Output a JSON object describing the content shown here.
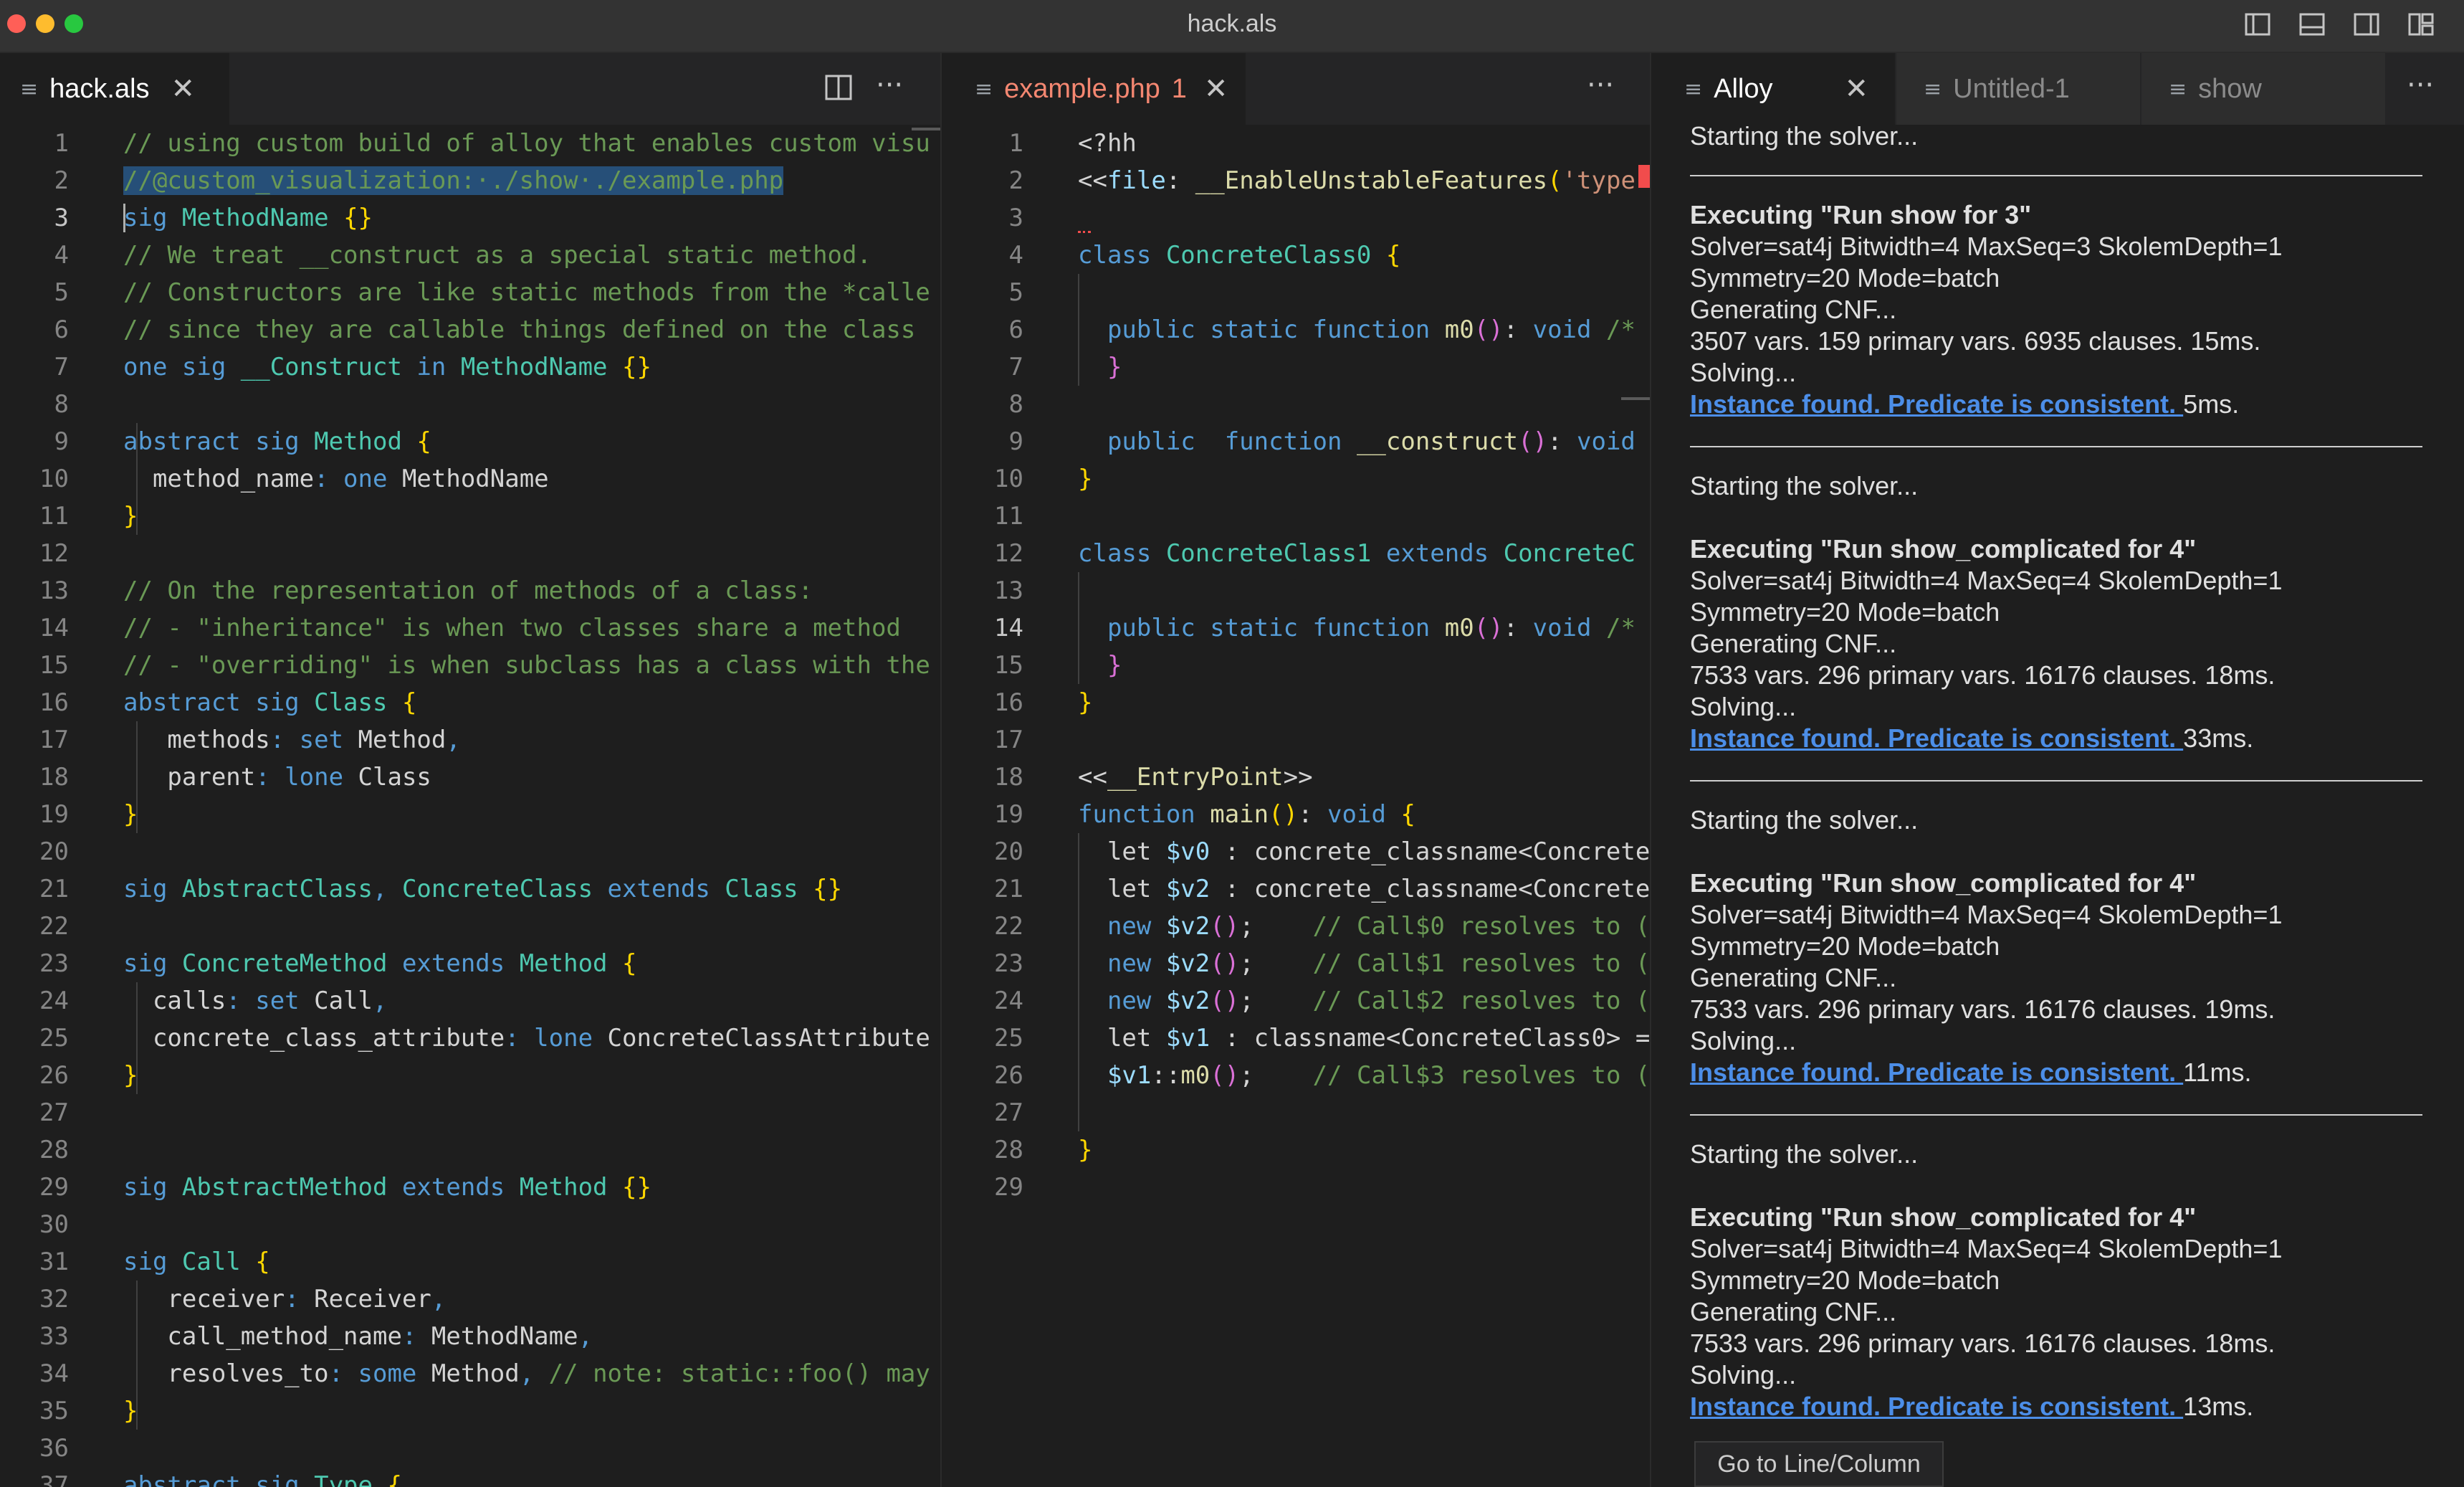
{
  "window": {
    "title": "hack.als"
  },
  "left_pane": {
    "tab": {
      "label": "hack.als",
      "close": "✕"
    },
    "split_icon": "split-editor-icon",
    "more_label": "···",
    "current_line": 3,
    "lines": [
      {
        "n": "1",
        "tokens": [
          [
            "cm",
            "// using custom build of alloy that enables custom visu"
          ]
        ]
      },
      {
        "n": "2",
        "tokens": [
          [
            "cm sel",
            "//@custom_visualization:·./show·./example.php"
          ]
        ]
      },
      {
        "n": "3",
        "tokens": [
          [
            "kw",
            "sig "
          ],
          [
            "ty",
            "MethodName "
          ],
          [
            "br",
            "{}"
          ]
        ]
      },
      {
        "n": "4",
        "tokens": [
          [
            "cm",
            "// We treat __construct as a special static method."
          ]
        ]
      },
      {
        "n": "5",
        "tokens": [
          [
            "cm",
            "// Constructors are like static methods from the *calle"
          ]
        ]
      },
      {
        "n": "6",
        "tokens": [
          [
            "cm",
            "// since they are callable things defined on the class"
          ]
        ]
      },
      {
        "n": "7",
        "tokens": [
          [
            "kw",
            "one sig "
          ],
          [
            "ty",
            "__Construct "
          ],
          [
            "kw",
            "in "
          ],
          [
            "ty",
            "MethodName "
          ],
          [
            "br",
            "{}"
          ]
        ]
      },
      {
        "n": "8",
        "tokens": []
      },
      {
        "n": "9",
        "tokens": [
          [
            "kw",
            "abstract sig "
          ],
          [
            "ty",
            "Method "
          ],
          [
            "br",
            "{"
          ]
        ]
      },
      {
        "n": "10",
        "tokens": [
          [
            "pl",
            "  method_name"
          ],
          [
            "kw",
            ": one "
          ],
          [
            "pl",
            "MethodName"
          ]
        ]
      },
      {
        "n": "11",
        "tokens": [
          [
            "br",
            "}"
          ]
        ]
      },
      {
        "n": "12",
        "tokens": []
      },
      {
        "n": "13",
        "tokens": [
          [
            "cm",
            "// On the representation of methods of a class:"
          ]
        ]
      },
      {
        "n": "14",
        "tokens": [
          [
            "cm",
            "// - \"inheritance\" is when two classes share a method"
          ]
        ]
      },
      {
        "n": "15",
        "tokens": [
          [
            "cm",
            "// - \"overriding\" is when subclass has a class with the"
          ]
        ]
      },
      {
        "n": "16",
        "tokens": [
          [
            "kw",
            "abstract sig "
          ],
          [
            "ty",
            "Class "
          ],
          [
            "br",
            "{"
          ]
        ]
      },
      {
        "n": "17",
        "tokens": [
          [
            "pl",
            "   methods"
          ],
          [
            "kw",
            ": set "
          ],
          [
            "pl",
            "Method"
          ],
          [
            "kw",
            ","
          ]
        ]
      },
      {
        "n": "18",
        "tokens": [
          [
            "pl",
            "   parent"
          ],
          [
            "kw",
            ": lone "
          ],
          [
            "pl",
            "Class"
          ]
        ]
      },
      {
        "n": "19",
        "tokens": [
          [
            "br",
            "}"
          ]
        ]
      },
      {
        "n": "20",
        "tokens": []
      },
      {
        "n": "21",
        "tokens": [
          [
            "kw",
            "sig "
          ],
          [
            "ty",
            "AbstractClass"
          ],
          [
            "kw",
            ", "
          ],
          [
            "ty",
            "ConcreteClass "
          ],
          [
            "kw",
            "extends "
          ],
          [
            "ty",
            "Class "
          ],
          [
            "br",
            "{}"
          ]
        ]
      },
      {
        "n": "22",
        "tokens": []
      },
      {
        "n": "23",
        "tokens": [
          [
            "kw",
            "sig "
          ],
          [
            "ty",
            "ConcreteMethod "
          ],
          [
            "kw",
            "extends "
          ],
          [
            "ty",
            "Method "
          ],
          [
            "br",
            "{"
          ]
        ]
      },
      {
        "n": "24",
        "tokens": [
          [
            "pl",
            "  calls"
          ],
          [
            "kw",
            ": set "
          ],
          [
            "pl",
            "Call"
          ],
          [
            "kw",
            ","
          ]
        ]
      },
      {
        "n": "25",
        "tokens": [
          [
            "pl",
            "  concrete_class_attribute"
          ],
          [
            "kw",
            ": lone "
          ],
          [
            "pl",
            "ConcreteClassAttribute"
          ]
        ]
      },
      {
        "n": "26",
        "tokens": [
          [
            "br",
            "}"
          ]
        ]
      },
      {
        "n": "27",
        "tokens": []
      },
      {
        "n": "28",
        "tokens": []
      },
      {
        "n": "29",
        "tokens": [
          [
            "kw",
            "sig "
          ],
          [
            "ty",
            "AbstractMethod "
          ],
          [
            "kw",
            "extends "
          ],
          [
            "ty",
            "Method "
          ],
          [
            "br",
            "{}"
          ]
        ]
      },
      {
        "n": "30",
        "tokens": []
      },
      {
        "n": "31",
        "tokens": [
          [
            "kw",
            "sig "
          ],
          [
            "ty",
            "Call "
          ],
          [
            "br",
            "{"
          ]
        ]
      },
      {
        "n": "32",
        "tokens": [
          [
            "pl",
            "   receiver"
          ],
          [
            "kw",
            ": "
          ],
          [
            "pl",
            "Receiver"
          ],
          [
            "kw",
            ","
          ]
        ]
      },
      {
        "n": "33",
        "tokens": [
          [
            "pl",
            "   call_method_name"
          ],
          [
            "kw",
            ": "
          ],
          [
            "pl",
            "MethodName"
          ],
          [
            "kw",
            ","
          ]
        ]
      },
      {
        "n": "34",
        "tokens": [
          [
            "pl",
            "   resolves_to"
          ],
          [
            "kw",
            ": some "
          ],
          [
            "pl",
            "Method"
          ],
          [
            "kw",
            ", "
          ],
          [
            "cm",
            "// note: static::foo() may"
          ]
        ]
      },
      {
        "n": "35",
        "tokens": [
          [
            "br",
            "}"
          ]
        ]
      },
      {
        "n": "36",
        "tokens": []
      },
      {
        "n": "37",
        "tokens": [
          [
            "kw",
            "abstract sig "
          ],
          [
            "ty",
            "Type "
          ],
          [
            "br",
            "{"
          ]
        ]
      }
    ]
  },
  "middle_pane": {
    "tab": {
      "label": "example.php",
      "badge": "1",
      "close": "✕"
    },
    "more_label": "···",
    "current_line": 14,
    "lines": [
      {
        "n": "1",
        "tokens": [
          [
            "pl",
            "<?hh"
          ]
        ]
      },
      {
        "n": "2",
        "tokens": [
          [
            "pl",
            "<<"
          ],
          [
            "va",
            "file"
          ],
          [
            "pl",
            ": "
          ],
          [
            "fn",
            "__EnableUnstableFeatures"
          ],
          [
            "br",
            "("
          ],
          [
            "st",
            "'type"
          ]
        ]
      },
      {
        "n": "3",
        "tokens": []
      },
      {
        "n": "4",
        "tokens": [
          [
            "kw",
            "class "
          ],
          [
            "ty",
            "ConcreteClass0 "
          ],
          [
            "br",
            "{"
          ]
        ]
      },
      {
        "n": "5",
        "tokens": []
      },
      {
        "n": "6",
        "tokens": [
          [
            "kw",
            "  public static function "
          ],
          [
            "fn",
            "m0"
          ],
          [
            "br2",
            "()"
          ],
          [
            "pl",
            ": "
          ],
          [
            "kw",
            "void "
          ],
          [
            "cm",
            "/*"
          ]
        ]
      },
      {
        "n": "7",
        "tokens": [
          [
            "br2",
            "  }"
          ]
        ]
      },
      {
        "n": "8",
        "tokens": []
      },
      {
        "n": "9",
        "tokens": [
          [
            "kw",
            "  public  function "
          ],
          [
            "fn",
            "__construct"
          ],
          [
            "br2",
            "()"
          ],
          [
            "pl",
            ": "
          ],
          [
            "kw",
            "void"
          ]
        ]
      },
      {
        "n": "10",
        "tokens": [
          [
            "br",
            "}"
          ]
        ]
      },
      {
        "n": "11",
        "tokens": []
      },
      {
        "n": "12",
        "tokens": [
          [
            "kw",
            "class "
          ],
          [
            "ty",
            "ConcreteClass1 "
          ],
          [
            "kw",
            "extends "
          ],
          [
            "ty",
            "ConcreteC"
          ]
        ]
      },
      {
        "n": "13",
        "tokens": []
      },
      {
        "n": "14",
        "tokens": [
          [
            "kw",
            "  public static function "
          ],
          [
            "fn",
            "m0"
          ],
          [
            "br2",
            "()"
          ],
          [
            "pl",
            ": "
          ],
          [
            "kw",
            "void "
          ],
          [
            "cm",
            "/*"
          ]
        ]
      },
      {
        "n": "15",
        "tokens": [
          [
            "br2",
            "  }"
          ]
        ]
      },
      {
        "n": "16",
        "tokens": [
          [
            "br",
            "}"
          ]
        ]
      },
      {
        "n": "17",
        "tokens": []
      },
      {
        "n": "18",
        "tokens": [
          [
            "pl",
            "<<"
          ],
          [
            "fn",
            "__EntryPoint"
          ],
          [
            "pl",
            ">>"
          ]
        ]
      },
      {
        "n": "19",
        "tokens": [
          [
            "kw",
            "function "
          ],
          [
            "fn",
            "main"
          ],
          [
            "br",
            "()"
          ],
          [
            "pl",
            ": "
          ],
          [
            "kw",
            "void "
          ],
          [
            "br",
            "{"
          ]
        ]
      },
      {
        "n": "20",
        "tokens": [
          [
            "pl",
            "  let "
          ],
          [
            "va",
            "$v0"
          ],
          [
            "pl",
            " : concrete_classname<Concrete"
          ]
        ]
      },
      {
        "n": "21",
        "tokens": [
          [
            "pl",
            "  let "
          ],
          [
            "va",
            "$v2"
          ],
          [
            "pl",
            " : concrete_classname<Concrete"
          ]
        ]
      },
      {
        "n": "22",
        "tokens": [
          [
            "kw",
            "  new "
          ],
          [
            "va",
            "$v2"
          ],
          [
            "br2",
            "()"
          ],
          [
            "pl",
            ";    "
          ],
          [
            "cm",
            "// Call$0 resolves to ("
          ]
        ]
      },
      {
        "n": "23",
        "tokens": [
          [
            "kw",
            "  new "
          ],
          [
            "va",
            "$v2"
          ],
          [
            "br2",
            "()"
          ],
          [
            "pl",
            ";    "
          ],
          [
            "cm",
            "// Call$1 resolves to ("
          ]
        ]
      },
      {
        "n": "24",
        "tokens": [
          [
            "kw",
            "  new "
          ],
          [
            "va",
            "$v2"
          ],
          [
            "br2",
            "()"
          ],
          [
            "pl",
            ";    "
          ],
          [
            "cm",
            "// Call$2 resolves to ("
          ]
        ]
      },
      {
        "n": "25",
        "tokens": [
          [
            "pl",
            "  let "
          ],
          [
            "va",
            "$v1"
          ],
          [
            "pl",
            " : classname<ConcreteClass0> ="
          ]
        ]
      },
      {
        "n": "26",
        "tokens": [
          [
            "va",
            "  $v1"
          ],
          [
            "pl",
            "::"
          ],
          [
            "fn",
            "m0"
          ],
          [
            "br2",
            "()"
          ],
          [
            "pl",
            ";    "
          ],
          [
            "cm",
            "// Call$3 resolves to ("
          ]
        ]
      },
      {
        "n": "27",
        "tokens": []
      },
      {
        "n": "28",
        "tokens": [
          [
            "br",
            "}"
          ]
        ]
      },
      {
        "n": "29",
        "tokens": []
      }
    ]
  },
  "right_pane": {
    "tabs": [
      {
        "label": "Alloy",
        "close": "✕",
        "active": true
      },
      {
        "label": "Untitled-1",
        "active": false
      },
      {
        "label": "show",
        "active": false
      }
    ],
    "more_label": "···",
    "output_blocks": [
      {
        "starting": "Starting the solver...",
        "executing": "",
        "lines": [],
        "result_link": "",
        "result_time": ""
      },
      {
        "starting": "",
        "executing": "Executing \"Run show for 3\"",
        "lines": [
          "Solver=sat4j Bitwidth=4 MaxSeq=3 SkolemDepth=1",
          "Symmetry=20 Mode=batch",
          "Generating CNF...",
          "3507 vars. 159 primary vars. 6935 clauses. 15ms.",
          "Solving..."
        ],
        "result_link": "Instance found. Predicate is consistent. ",
        "result_time": "5ms."
      },
      {
        "starting": "Starting the solver...",
        "executing": "Executing \"Run show_complicated for 4\"",
        "lines": [
          "Solver=sat4j Bitwidth=4 MaxSeq=4 SkolemDepth=1",
          "Symmetry=20 Mode=batch",
          "Generating CNF...",
          "7533 vars. 296 primary vars. 16176 clauses. 18ms.",
          "Solving..."
        ],
        "result_link": "Instance found. Predicate is consistent. ",
        "result_time": "33ms."
      },
      {
        "starting": "Starting the solver...",
        "executing": "Executing \"Run show_complicated for 4\"",
        "lines": [
          "Solver=sat4j Bitwidth=4 MaxSeq=4 SkolemDepth=1",
          "Symmetry=20 Mode=batch",
          "Generating CNF...",
          "7533 vars. 296 primary vars. 16176 clauses. 19ms.",
          "Solving..."
        ],
        "result_link": "Instance found. Predicate is consistent. ",
        "result_time": "11ms."
      },
      {
        "starting": "Starting the solver...",
        "executing": "Executing \"Run show_complicated for 4\"",
        "lines": [
          "Solver=sat4j Bitwidth=4 MaxSeq=4 SkolemDepth=1",
          "Symmetry=20 Mode=batch",
          "Generating CNF...",
          "7533 vars. 296 primary vars. 16176 clauses. 18ms.",
          "Solving..."
        ],
        "result_link": "Instance found. Predicate is consistent. ",
        "result_time": "13ms."
      }
    ],
    "tooltip": "Go to Line/Column"
  },
  "colors": {
    "comment": "#6a9955",
    "keyword": "#569cd6",
    "type": "#4ec9b0",
    "bracket": "#ffd700",
    "link": "#4c8ee8",
    "error_tab": "#f48771"
  }
}
